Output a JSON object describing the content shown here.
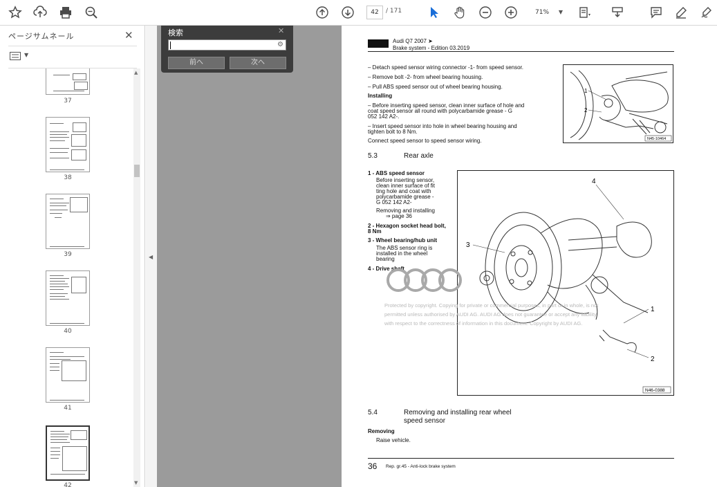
{
  "toolbar": {
    "page_current": "42",
    "page_total": "/ 171",
    "zoom": "71%",
    "icons": [
      "star-icon",
      "upload-icon",
      "print-icon",
      "zoom-search-icon",
      "page-up-icon",
      "page-down-icon",
      "select-cursor-icon",
      "hand-icon",
      "zoom-out-icon",
      "zoom-in-icon",
      "fit-page-icon",
      "scroll-mode-icon",
      "comment-icon",
      "highlight-icon",
      "sign-icon"
    ]
  },
  "sidebar": {
    "title": "ページサムネール",
    "pages": [
      {
        "label": "37"
      },
      {
        "label": "38"
      },
      {
        "label": "39"
      },
      {
        "label": "40"
      },
      {
        "label": "41"
      },
      {
        "label": "42"
      }
    ]
  },
  "find": {
    "title": "検索",
    "input_value": "",
    "prev_label": "前へ",
    "next_label": "次へ"
  },
  "document": {
    "header_title": "Audi Q7 2007 ➤",
    "header_sub": "Brake system - Edition 03.2019",
    "steps_removal": [
      "–  Detach speed sensor wiring connector -1- from speed sensor.",
      "–  Remove bolt -2- from wheel bearing housing.",
      "–  Pull ABS speed sensor out of wheel bearing housing."
    ],
    "installing_heading": "Installing",
    "install_steps": [
      "–  Before inserting speed sensor, clean inner surface of hole and",
      "    coat speed sensor all round with polycarbamide grease - G",
      "    052 142 A2-.",
      "–  Insert speed sensor into hole in wheel bearing housing and",
      "    tighten bolt to 8 Nm.",
      "    Connect speed sensor to speed sensor wiring."
    ],
    "fig1_code": "N45-10464",
    "fig1_labels": [
      "1",
      "2"
    ],
    "section_num": "5.3",
    "section_title": "Rear axle",
    "legend": [
      "1 - ABS speed sensor",
      "     Before inserting sensor,",
      "     clean inner surface of fit",
      "     ting hole and coat with",
      "     polycarbamide grease -",
      "     G 052 142 A2-",
      "     Removing and installing",
      "2 - Hexagon socket head bolt,",
      "8 Nm",
      "3 - Wheel bearing/hub unit",
      "     The ABS sensor ring is",
      "     installed in the wheel",
      "     bearing",
      "4 - Drive shaft"
    ],
    "legend_link": "⇒ page 36",
    "fig2_code": "N46-0388",
    "fig2_labels": [
      "4",
      "3",
      "1",
      "2"
    ],
    "watermark": [
      "Protected by copyright. Copying for private or commercial purposes, in part or in whole, is not",
      "permitted unless authorised by AUDI AG. AUDI AG does not guarantee or accept any liability",
      "with respect to the correctness of information in this document. Copyright by AUDI AG."
    ],
    "section2_num": "5.4",
    "section2_title_1": "Removing and installing rear wheel",
    "section2_title_2": "speed sensor",
    "removing_heading": "Removing",
    "removing_step": "Raise vehicle.",
    "footer_page": "36",
    "footer_text": "Rep. gr.45 - Anti-lock brake system"
  },
  "colors": {
    "toolbar_bg": "#ffffff",
    "workspace_bg": "#9b9b9b",
    "find_bg": "#3c3c3c",
    "link_red": "#dd2211",
    "select_cursor_blue": "#1a6ed8"
  }
}
